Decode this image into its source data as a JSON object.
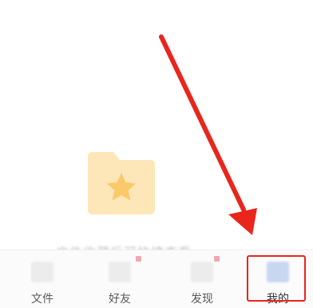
{
  "empty_state": {
    "icon": "folder-star-icon",
    "message": "文件收藏后可快捷查看"
  },
  "tabbar": {
    "tabs": [
      {
        "label": "文件",
        "icon": "files-icon"
      },
      {
        "label": "好友",
        "icon": "friends-icon"
      },
      {
        "label": "发现",
        "icon": "discover-icon"
      },
      {
        "label": "我的",
        "icon": "profile-icon"
      }
    ],
    "selected": "我的"
  },
  "annotation": {
    "type": "red-arrow-pointing-to-tab",
    "color": "#e8261c"
  },
  "colors": {
    "folder": "#fde7b8",
    "star": "#fbc96a",
    "highlight": "#e8261c"
  }
}
